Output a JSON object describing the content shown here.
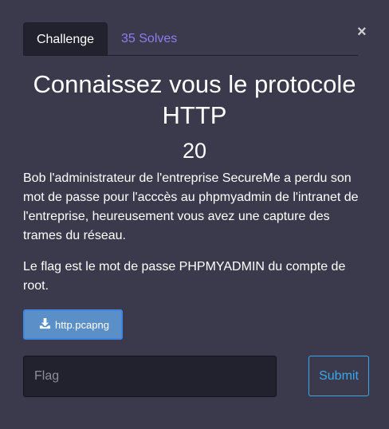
{
  "modal": {
    "close_glyph": "×",
    "tabs": [
      {
        "label": "Challenge"
      },
      {
        "label": "35 Solves"
      }
    ],
    "challenge": {
      "title": "Connaissez vous le protocole HTTP",
      "value": "20",
      "description": [
        "Bob l'administrateur de l'entreprise SecureMe a perdu son mot de passe pour l'acccès au phpmyadmin de l'intranet de l'entreprise, heureusement vous avez une capture des trames du réseau.",
        "Le flag est le mot de passe PHPMYADMIN du compte de root."
      ],
      "file": {
        "label": "http.pcapng",
        "icon": "download-icon"
      }
    },
    "form": {
      "flag_placeholder": "Flag",
      "flag_value": "",
      "submit_label": "Submit"
    }
  },
  "colors": {
    "background": "#3b3a4d",
    "tab_active_bg": "#22222f",
    "solves_link": "#8d7cf2",
    "submit_accent": "#3aa8e8",
    "file_button_bg": "#5b8fc8"
  }
}
